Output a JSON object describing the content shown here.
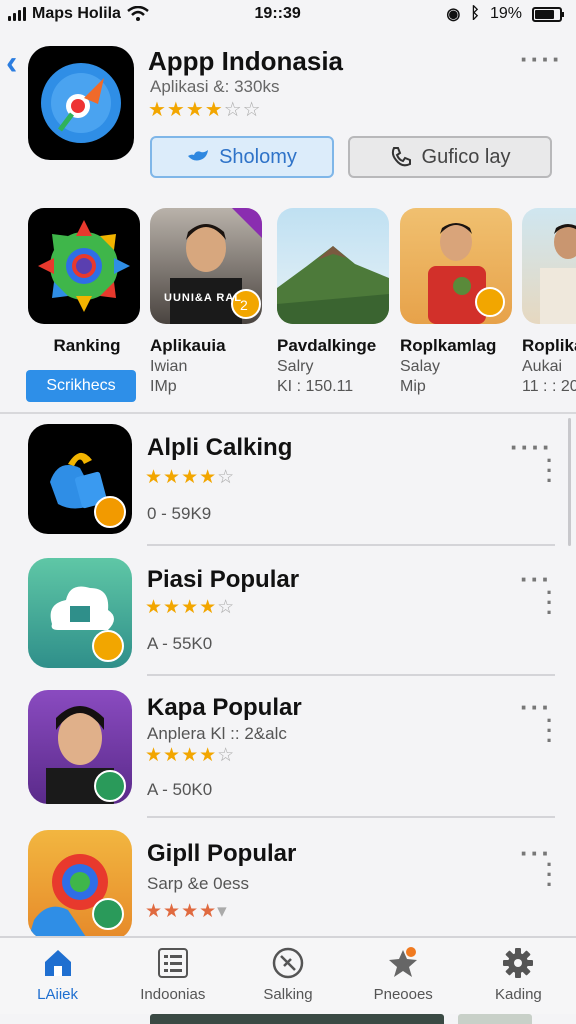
{
  "status_bar": {
    "carrier": "Maps Holila",
    "time": "19::39",
    "battery": "19%"
  },
  "header": {
    "title": "Appp Indonasia",
    "subtitle": "Aplikasi &: 330ks",
    "rating_stars": 4,
    "primary_button": "Sholomy",
    "secondary_button": "Gufico lay"
  },
  "carousel": {
    "items": [
      {
        "title": "Ranking",
        "line1": "",
        "line2": "",
        "button": "Scrikhecs"
      },
      {
        "title": "Aplikauia",
        "line1": "Iwian",
        "line2": "IMp",
        "overlay_text": "UUNI&A RAL"
      },
      {
        "title": "Pavdalkinge",
        "line1": "Salry",
        "line2": "KI : 150.11"
      },
      {
        "title": "Roplkamlag",
        "line1": "Salay",
        "line2": "Mip"
      },
      {
        "title": "Roplika",
        "line1": "Aukai",
        "line2": "11 : : 20"
      }
    ]
  },
  "list": {
    "rows": [
      {
        "title": "Alpli Calking",
        "subtitle": "",
        "stars": 4,
        "meta": "0 - 59K9"
      },
      {
        "title": "Piasi Popular",
        "subtitle": "",
        "stars": 4,
        "meta": "A - 55K0"
      },
      {
        "title": "Kapa Popular",
        "subtitle": "Anplera Kl :: 2&alc",
        "stars": 4,
        "meta": "A - 50K0"
      },
      {
        "title": "Gipll Popular",
        "subtitle": "Sarp &e 0ess",
        "stars": 3.5,
        "meta": ""
      }
    ]
  },
  "tabbar": {
    "tabs": [
      {
        "label": "LAiiek",
        "icon": "home-icon",
        "active": true
      },
      {
        "label": "Indoonias",
        "icon": "list-icon",
        "active": false
      },
      {
        "label": "Salking",
        "icon": "compass-icon",
        "active": false
      },
      {
        "label": "Pneooes",
        "icon": "star-badge-icon",
        "active": false
      },
      {
        "label": "Kading",
        "icon": "gear-icon",
        "active": false
      }
    ]
  },
  "colors": {
    "accent": "#2e8fe8",
    "star": "#f2a600",
    "background": "#f4f4f6"
  }
}
